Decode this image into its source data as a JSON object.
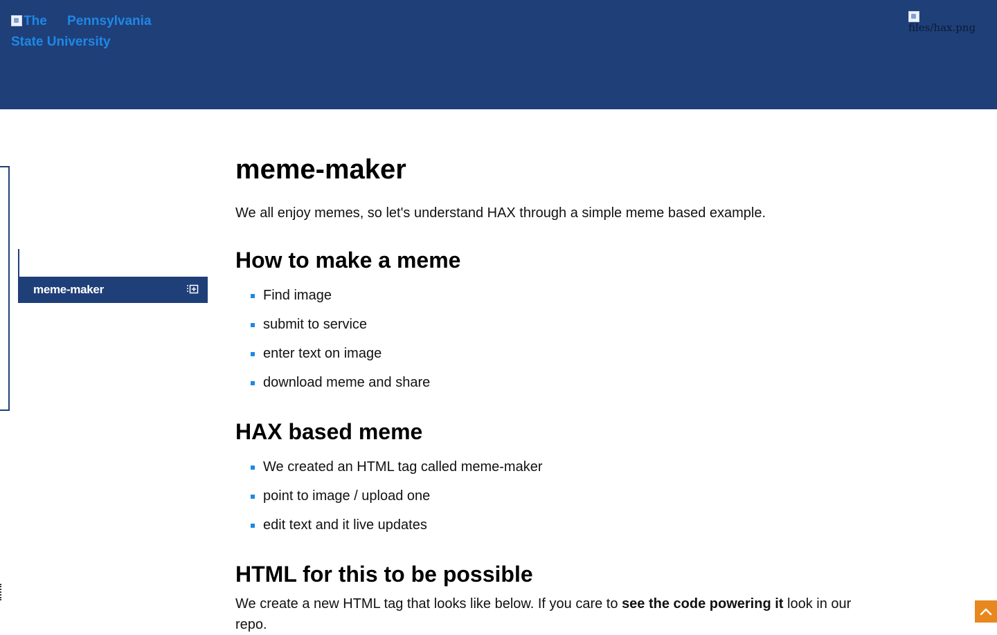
{
  "header": {
    "logo_alt_line1": "The Pennsylvania",
    "logo_alt_line2": "State University",
    "hax_image_alt": "files/hax.png"
  },
  "sidebar": {
    "items": [
      {
        "label": "meme-maker",
        "active": true
      }
    ]
  },
  "content": {
    "title": "meme-maker",
    "intro": "We all enjoy memes, so let's understand HAX through a simple meme based example.",
    "sections": [
      {
        "heading": "How to make a meme",
        "items": [
          "Find image",
          "submit to service",
          "enter text on image",
          "download meme and share"
        ]
      },
      {
        "heading": "HAX based meme",
        "items": [
          "We created an HTML tag called meme-maker",
          "point to image / upload one",
          "edit text and it live updates"
        ]
      },
      {
        "heading": "HTML for this to be possible",
        "para_before": "We create a new HTML tag that looks like below. If you care to",
        "para_bold": "see the code powering it",
        "para_after": "look in our repo."
      }
    ]
  },
  "colors": {
    "header_bg": "#1f3f79",
    "accent": "#1e88e5",
    "scroll_button": "#e8871e"
  },
  "icons": {
    "menu_item_icon": "outline-expand-icon",
    "scroll_top": "chevron-up-icon"
  }
}
